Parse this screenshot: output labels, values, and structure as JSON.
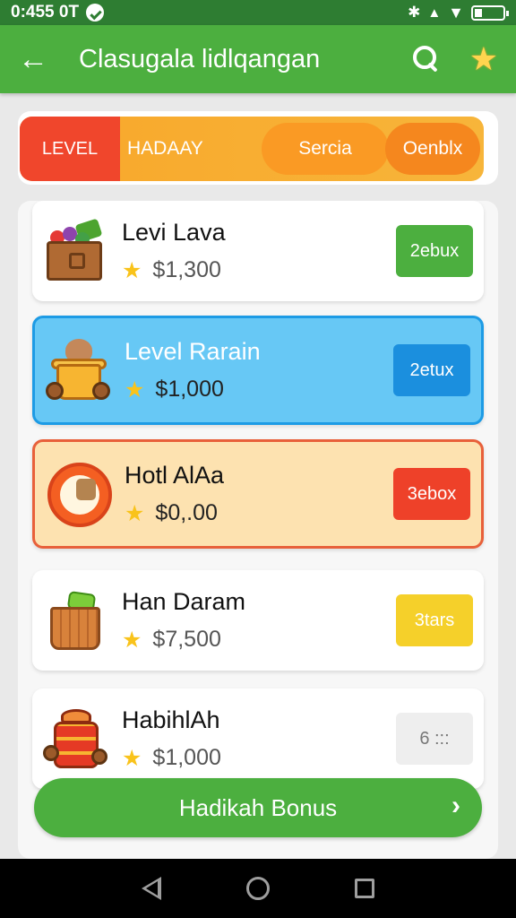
{
  "status_bar": {
    "time": "0:455 0T",
    "colors": {
      "background": "#2e7d32"
    }
  },
  "app_bar": {
    "title": "Clasugala lidlqangan",
    "back_icon": "arrow-left-icon",
    "search_icon": "search-icon",
    "star_icon": "star-icon"
  },
  "level_bar": {
    "level_label": "LEVEL",
    "name": "HADAAY",
    "search_label": "Sercia",
    "detail_label": "Oenblx"
  },
  "items": [
    {
      "name": "Levi Lava",
      "price": "$1,300",
      "button": "2ebux",
      "button_color": "#4caf3f",
      "icon": "fruit-crate-icon"
    },
    {
      "name": "Level Rarain",
      "price": "$1,000",
      "button": "2etux",
      "button_color": "#1b8fde",
      "icon": "cat-pot-icon"
    },
    {
      "name": "Hotl AlAa",
      "price": "$0,.00",
      "button": "3ebox",
      "button_color": "#ee4129",
      "icon": "coin-icon"
    },
    {
      "name": "Han Daram",
      "price": "$7,500",
      "button": "3tars",
      "button_color": "#f5d02a",
      "icon": "gift-basket-icon"
    },
    {
      "name": "HabihlAh",
      "price": "$1,000",
      "button": "6 :::",
      "button_color": "#eeeeee",
      "icon": "drum-icon"
    }
  ],
  "bottom_button": {
    "label": "Hadikah Bonus",
    "chevron": "›"
  },
  "nav": {
    "back": "nav-back-icon",
    "home": "nav-home-icon",
    "recent": "nav-recent-icon"
  }
}
